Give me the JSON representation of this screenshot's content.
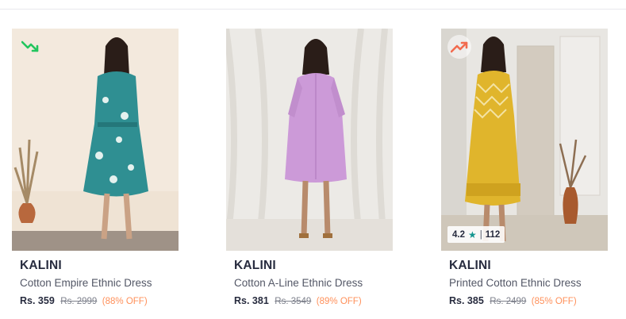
{
  "products": [
    {
      "brand": "KALINI",
      "name": "Cotton Empire Ethnic Dress",
      "price": "Rs. 359",
      "mrp": "Rs. 2999",
      "discount": "(88% OFF)",
      "badge_icon": "trending-down-icon",
      "badge_color": "#22c55e",
      "dress_color": "#2f8f92"
    },
    {
      "brand": "KALINI",
      "name": "Cotton A-Line Ethnic Dress",
      "price": "Rs. 381",
      "mrp": "Rs. 3549",
      "discount": "(89% OFF)",
      "dress_color": "#cc9ad8"
    },
    {
      "brand": "KALINI",
      "name": "Printed Cotton Ethnic Dress",
      "price": "Rs. 385",
      "mrp": "Rs. 2499",
      "discount": "(85% OFF)",
      "badge_icon": "trending-up-icon",
      "badge_color": "#f26b4f",
      "dress_color": "#e0b52c",
      "rating": "4.2",
      "rating_star": "★",
      "rating_separator": "|",
      "rating_count": "112"
    }
  ],
  "colors": {
    "brand_text": "#282c3f",
    "name_text": "#535766",
    "mrp_text": "#7e818c",
    "discount_text": "#ff905a",
    "rating_star": "#14958f"
  }
}
